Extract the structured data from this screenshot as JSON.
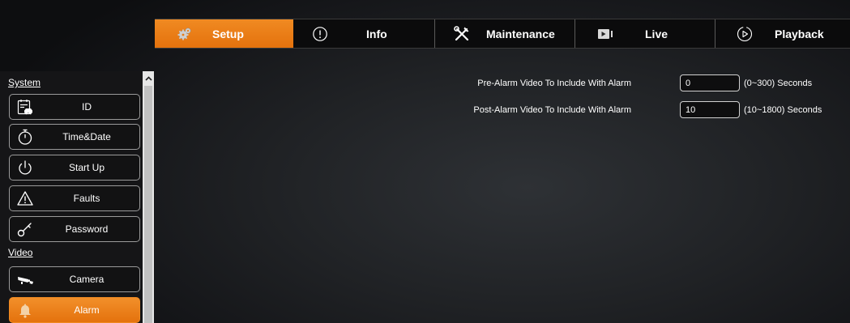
{
  "tabs": [
    {
      "label": "Setup",
      "icon": "gear-icon",
      "active": true
    },
    {
      "label": "Info",
      "icon": "info-icon",
      "active": false
    },
    {
      "label": "Maintenance",
      "icon": "tools-icon",
      "active": false
    },
    {
      "label": "Live",
      "icon": "video-camera-icon",
      "active": false
    },
    {
      "label": "Playback",
      "icon": "play-circle-icon",
      "active": false
    }
  ],
  "sidebar": {
    "system_title": "System",
    "video_title": "Video",
    "items": [
      {
        "label": "ID",
        "icon": "id-card-icon"
      },
      {
        "label": "Time&Date",
        "icon": "stopwatch-icon"
      },
      {
        "label": "Start Up",
        "icon": "power-icon"
      },
      {
        "label": "Faults",
        "icon": "warning-icon"
      },
      {
        "label": "Password",
        "icon": "key-icon"
      },
      {
        "label": "Camera",
        "icon": "cctv-camera-icon"
      },
      {
        "label": "Alarm",
        "icon": "bell-icon",
        "active": true
      }
    ]
  },
  "alarm_settings": {
    "pre_alarm_label": "Pre-Alarm Video To Include With Alarm",
    "pre_alarm_value": "0",
    "pre_alarm_hint": "(0~300) Seconds",
    "post_alarm_label": "Post-Alarm Video To Include With Alarm",
    "post_alarm_value": "10",
    "post_alarm_hint": "(10~1800) Seconds"
  },
  "colors": {
    "accent": "#e87a14",
    "background": "#1a1b1d",
    "text": "#ffffff"
  }
}
